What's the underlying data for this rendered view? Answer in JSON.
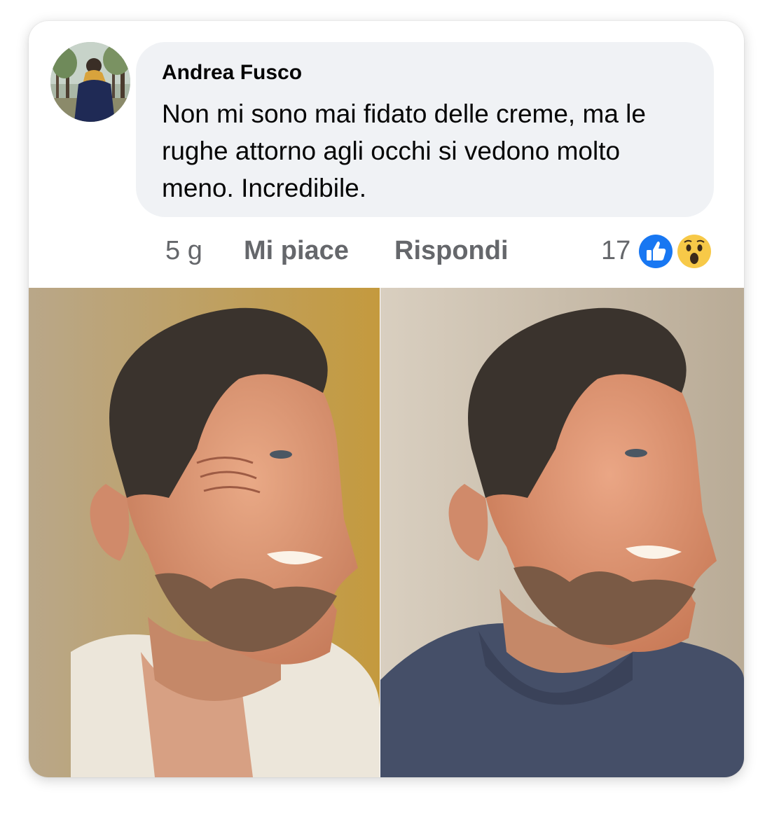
{
  "comment": {
    "author": "Andrea Fusco",
    "text": "Non mi sono mai fidato delle creme, ma le rughe attorno agli occhi si vedono molto meno. Incredibile.",
    "time": "5 g",
    "like_label": "Mi piace",
    "reply_label": "Rispondi",
    "reaction_count": "17",
    "reactions": [
      "like-icon",
      "wow-icon"
    ]
  },
  "colors": {
    "bubble": "#f0f2f5",
    "text": "#050505",
    "secondary_text": "#65676b",
    "like_blue": "#1877f2",
    "wow_yellow": "#f7c948"
  }
}
